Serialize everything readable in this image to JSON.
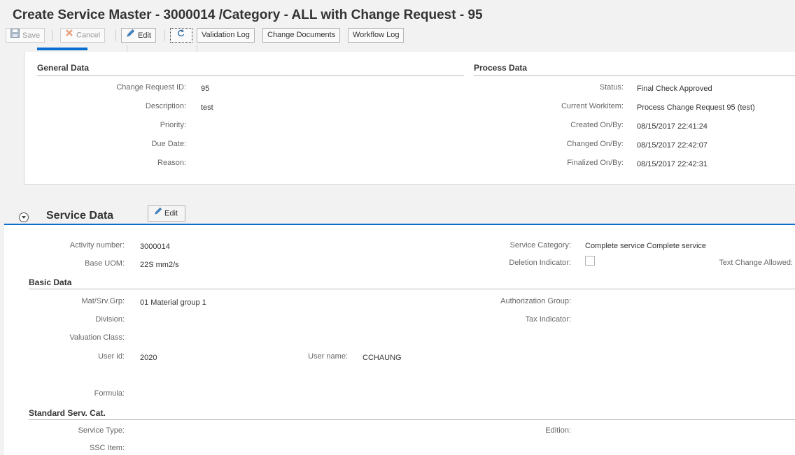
{
  "title": "Create Service Master - 3000014 /Category - ALL with Change Request - 95",
  "toolbar": {
    "save": "Save",
    "cancel": "Cancel",
    "edit": "Edit",
    "validation_log": "Validation Log",
    "change_documents": "Change Documents",
    "workflow_log": "Workflow Log"
  },
  "general_data": {
    "heading": "General Data",
    "fields": [
      {
        "label": "Change Request ID:",
        "value": "95"
      },
      {
        "label": "Description:",
        "value": "test"
      },
      {
        "label": "Priority:",
        "value": ""
      },
      {
        "label": "Due Date:",
        "value": ""
      },
      {
        "label": "Reason:",
        "value": ""
      }
    ]
  },
  "process_data": {
    "heading": "Process Data",
    "fields": [
      {
        "label": "Status:",
        "value": "Final Check Approved"
      },
      {
        "label": "Current Workitem:",
        "value": "Process Change Request  95 (test)"
      },
      {
        "label": "Created On/By:",
        "value": "08/15/2017 22:41:24"
      },
      {
        "label": "Changed On/By:",
        "value": "08/15/2017 22:42:07"
      },
      {
        "label": "Finalized On/By:",
        "value": "08/15/2017 22:42:31"
      }
    ]
  },
  "service_data": {
    "heading": "Service Data",
    "edit": "Edit",
    "activity_number_label": "Activity number:",
    "activity_number": "3000014",
    "base_uom_label": "Base UOM:",
    "base_uom": "22S mm2/s",
    "service_category_label": "Service Category:",
    "service_category": "Complete service Complete service",
    "deletion_indicator_label": "Deletion Indicator:",
    "text_change_label": "Text Change Allowed:"
  },
  "basic_data": {
    "heading": "Basic Data",
    "mat_srv_grp_label": "Mat/Srv.Grp:",
    "mat_srv_grp": "01 Material group 1",
    "division_label": "Division:",
    "valuation_class_label": "Valuation Class:",
    "user_id_label": "User id:",
    "user_id": "2020",
    "user_name_label": "User name:",
    "user_name": "CCHAUNG",
    "formula_label": "Formula:",
    "authorization_group_label": "Authorization Group:",
    "tax_indicator_label": "Tax Indicator:"
  },
  "standard_serv_cat": {
    "heading": "Standard Serv. Cat.",
    "service_type_label": "Service Type:",
    "ssc_item_label": "SSC Item:",
    "edition_label": "Edition:"
  }
}
